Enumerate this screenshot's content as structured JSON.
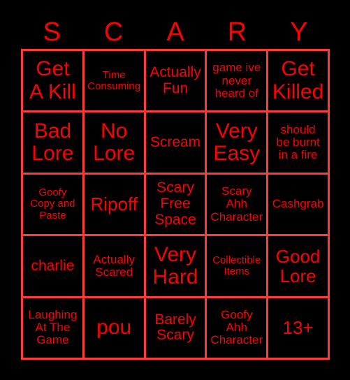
{
  "card": {
    "header_letters": [
      "S",
      "C",
      "A",
      "R",
      "Y"
    ],
    "colors": {
      "background": "#000000",
      "text": "#ff0000",
      "border": "#ff3b3b"
    },
    "grid": {
      "columns": 5,
      "rows": 5,
      "free_space_index": 12
    },
    "cells": [
      {
        "text": "Get\nA Kill",
        "size": "xl"
      },
      {
        "text": "Time\nConsuming",
        "size": "xs"
      },
      {
        "text": "Actually\nFun",
        "size": "md"
      },
      {
        "text": "game ive\nnever\nheard of",
        "size": "sm"
      },
      {
        "text": "Get\nKilled",
        "size": "xl"
      },
      {
        "text": "Bad\nLore",
        "size": "xl"
      },
      {
        "text": "No\nLore",
        "size": "xl"
      },
      {
        "text": "Scream",
        "size": "md"
      },
      {
        "text": "Very\nEasy",
        "size": "xl"
      },
      {
        "text": "should\nbe burnt\nin a fire",
        "size": "sm"
      },
      {
        "text": "Goofy\nCopy and\nPaste",
        "size": "xs"
      },
      {
        "text": "Ripoff",
        "size": "lg"
      },
      {
        "text": "Scary\nFree\nSpace",
        "size": "md"
      },
      {
        "text": "Scary\nAhh\nCharacter",
        "size": "sm"
      },
      {
        "text": "Cashgrab",
        "size": "sm"
      },
      {
        "text": "charlie",
        "size": "md"
      },
      {
        "text": "Actually\nScared",
        "size": "sm"
      },
      {
        "text": "Very\nHard",
        "size": "xl"
      },
      {
        "text": "Collectible\nItems",
        "size": "xs"
      },
      {
        "text": "Good\nLore",
        "size": "lg"
      },
      {
        "text": "Laughing\nAt The\nGame",
        "size": "sm"
      },
      {
        "text": "pou",
        "size": "xl"
      },
      {
        "text": "Barely\nScary",
        "size": "md"
      },
      {
        "text": "Goofy\nAhh\nCharacter",
        "size": "sm"
      },
      {
        "text": "13+",
        "size": "lg"
      }
    ]
  }
}
